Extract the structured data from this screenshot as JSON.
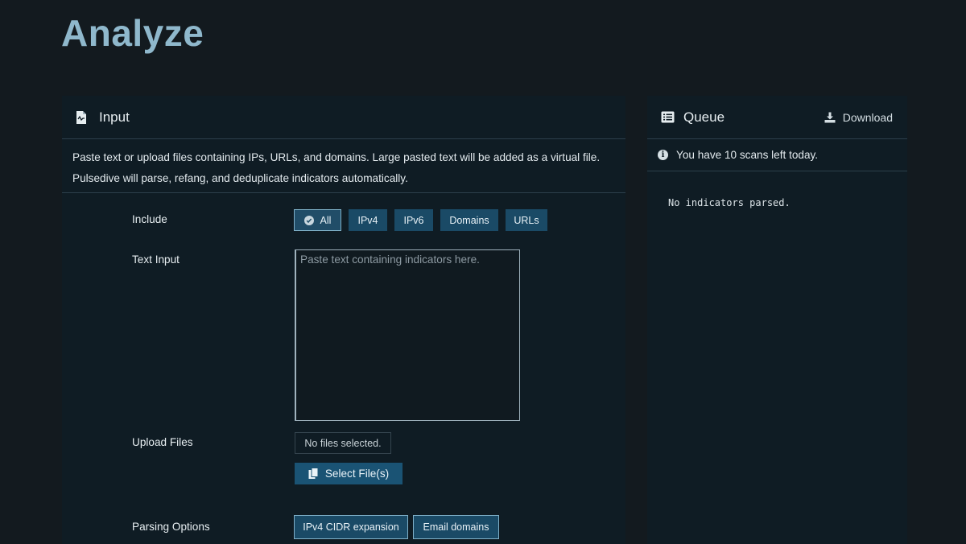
{
  "page": {
    "title": "Analyze"
  },
  "input": {
    "title": "Input",
    "description": "Paste text or upload files containing IPs, URLs, and domains. Large pasted text will be added as a virtual file. Pulsedive will parse, refang, and deduplicate indicators automatically.",
    "include_label": "Include",
    "include_options": [
      {
        "label": "All",
        "selected": true
      },
      {
        "label": "IPv4",
        "selected": false
      },
      {
        "label": "IPv6",
        "selected": false
      },
      {
        "label": "Domains",
        "selected": false
      },
      {
        "label": "URLs",
        "selected": false
      }
    ],
    "text_input_label": "Text Input",
    "text_input_placeholder": "Paste text containing indicators here.",
    "upload_label": "Upload Files",
    "upload_status": "No files selected.",
    "select_files_label": "Select File(s)",
    "parsing_label": "Parsing Options",
    "parsing_options": [
      {
        "label": "IPv4 CIDR expansion",
        "selected": true
      },
      {
        "label": "Email domains",
        "selected": true
      }
    ]
  },
  "queue": {
    "title": "Queue",
    "download_label": "Download",
    "info": "You have 10 scans left today.",
    "empty_message": "No indicators parsed."
  },
  "colors": {
    "background": "#131a1f",
    "panel": "#0f1c24",
    "accent": "#1a4a66",
    "title": "#8fb8cc"
  }
}
